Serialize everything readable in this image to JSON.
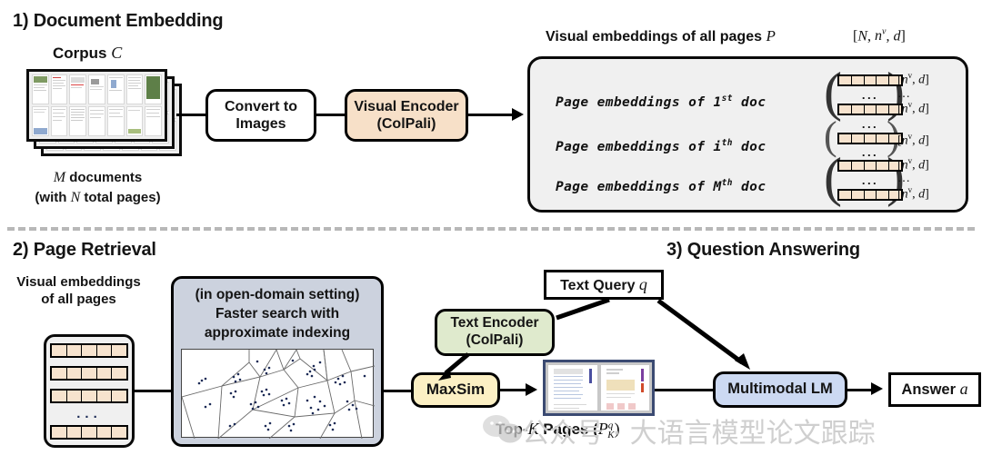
{
  "sections": {
    "one": "1) Document Embedding",
    "two": "2) Page Retrieval",
    "three": "3) Question Answering"
  },
  "corpus": {
    "title_prefix": "Corpus ",
    "title_symbol": "C",
    "caption_line1_pre": "",
    "caption_line1_sym": "M",
    "caption_line1_post": " documents",
    "caption_line2_pre": "(with ",
    "caption_line2_sym": "N",
    "caption_line2_post": " total pages)"
  },
  "pipeline1": {
    "convert": "Convert to\nImages",
    "convert_line1": "Convert to",
    "convert_line2": "Images",
    "encoder_line1": "Visual Encoder",
    "encoder_line2": "(ColPali)"
  },
  "panel": {
    "heading_text": "Visual embeddings of all pages ",
    "heading_symbol": "P",
    "heading_dims": "[N, nᵛ, d]",
    "rows": [
      {
        "label_pre": "Page embeddings of ",
        "label_idx": "1",
        "label_sup": "st",
        "label_post": " doc",
        "vectors": 2,
        "dims": [
          "[nᵛ, d]",
          "…",
          "[nᵛ, d]"
        ]
      },
      {
        "label_pre": "Page embeddings of ",
        "label_idx": "i",
        "label_sup": "th",
        "label_post": " doc",
        "vectors": 1,
        "dims": [
          "[nᵛ, d]"
        ]
      },
      {
        "label_pre": "Page embeddings of ",
        "label_idx": "M",
        "label_sup": "th",
        "label_post": " doc",
        "vectors": 2,
        "dims": [
          "[nᵛ, d]",
          "…",
          "[nᵛ, d]"
        ]
      }
    ],
    "ellipsis": "..."
  },
  "retrieval": {
    "embeddings_caption_line1": "Visual embeddings",
    "embeddings_caption_line2": "of all pages",
    "search_line1": "(in open-domain setting)",
    "search_line2": "Faster search with",
    "search_line3": "approximate indexing",
    "maxsim": "MaxSim",
    "topk_pre": "Top-",
    "topk_k": "K",
    "topk_mid": " Pages (",
    "topk_sym": "P",
    "topk_sup": "q",
    "topk_sub": "K",
    "topk_post": ")"
  },
  "qa": {
    "text_query_label": "Text Query ",
    "text_query_symbol": "q",
    "text_encoder_line1": "Text Encoder",
    "text_encoder_line2": "(ColPali)",
    "mllm": "Multimodal LM",
    "answer_label": "Answer ",
    "answer_symbol": "a"
  },
  "watermark": {
    "text": "公众号 · 大语言模型论文跟踪"
  },
  "colors": {
    "encoder_peach": "#f7e0c8",
    "text_encoder_green": "#dfeacd",
    "maxsim_yellow": "#fcf0c4",
    "mllm_blue": "#ccd9f2",
    "search_grey_blue": "#ccd2de",
    "panel_grey": "#f0f0f0",
    "cell_peach": "#f7e3ce",
    "divider_grey": "#b8b8b8",
    "topk_border": "#3b4a72"
  }
}
